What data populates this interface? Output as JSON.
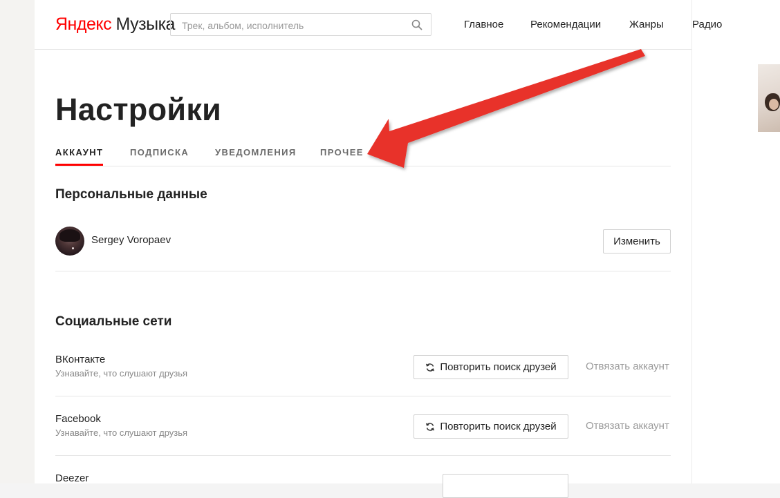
{
  "header": {
    "logo_brand": "Яндекс",
    "logo_product": "Музыка",
    "search_placeholder": "Трек, альбом, исполнитель",
    "nav": [
      "Главное",
      "Рекомендации",
      "Жанры",
      "Радио"
    ]
  },
  "page_title": "Настройки",
  "tabs": [
    "АККАУНТ",
    "ПОДПИСКА",
    "УВЕДОМЛЕНИЯ",
    "ПРОЧЕЕ"
  ],
  "active_tab": "АККАУНТ",
  "personal": {
    "heading": "Персональные данные",
    "user_name": "Sergey Voropaev",
    "edit_button": "Изменить"
  },
  "social": {
    "heading": "Социальные сети",
    "items": [
      {
        "name": "ВКонтакте",
        "description": "Узнавайте, что слушают друзья",
        "refresh_button": "Повторить поиск друзей",
        "unlink_label": "Отвязать аккаунт"
      },
      {
        "name": "Facebook",
        "description": "Узнавайте, что слушают друзья",
        "refresh_button": "Повторить поиск друзей",
        "unlink_label": "Отвязать аккаунт"
      },
      {
        "name": "Deezer"
      }
    ]
  },
  "colors": {
    "brand_red": "#ff0000",
    "annotation_arrow": "#e8322c"
  },
  "icons": [
    "search-icon",
    "refresh-icon"
  ]
}
